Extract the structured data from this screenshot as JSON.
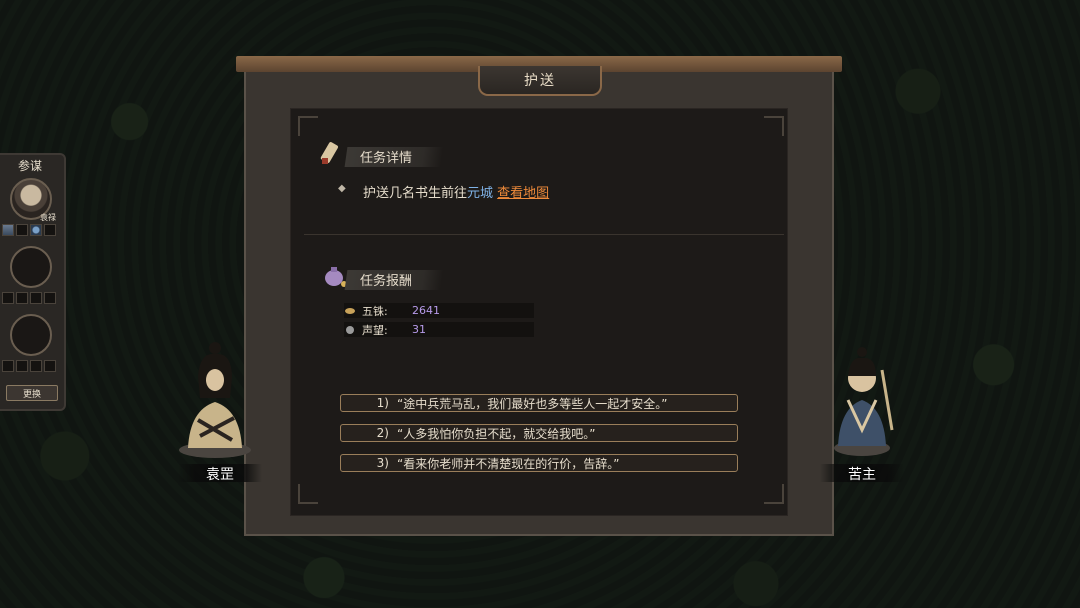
{
  "dialog": {
    "title": "护送",
    "task_section": "任务详情",
    "task_text_prefix": "护送几名书生前往",
    "task_city": "元城",
    "task_map_link": "查看地图",
    "reward_section": "任务报酬",
    "rewards": [
      {
        "label": "五铢:",
        "value": "2641"
      },
      {
        "label": "声望:",
        "value": "31"
      }
    ],
    "choices": [
      {
        "num": "1)",
        "text": "“途中兵荒马乱，我们最好也多等些人一起才安全。”"
      },
      {
        "num": "2)",
        "text": "“人多我怕你负担不起，就交给我吧。”"
      },
      {
        "num": "3)",
        "text": "“看来你老师并不清楚现在的行价，告辞。”"
      }
    ]
  },
  "left_panel": {
    "title": "参谋",
    "advisor_name": "袁禄",
    "swap_label": "更换"
  },
  "characters": {
    "left_name": "袁罡",
    "right_name": "苦主"
  },
  "colors": {
    "city_link": "#7fb2e6",
    "map_link": "#ee8a3a",
    "reward_value": "#b79bea",
    "choice_border": "#9a7e5a"
  }
}
